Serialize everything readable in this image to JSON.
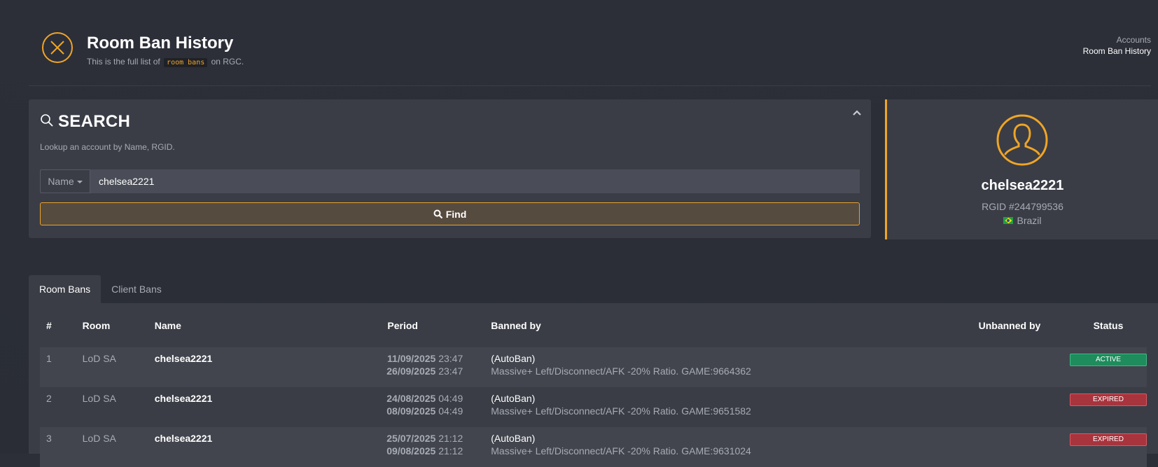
{
  "header": {
    "title": "Room Ban History",
    "subtitle_prefix": "This is the full list of",
    "subtitle_code": "room bans",
    "subtitle_suffix": "on RGC.",
    "breadcrumb": [
      "Accounts",
      "Room Ban History"
    ]
  },
  "search": {
    "title": "SEARCH",
    "description": "Lookup an account by Name, RGID.",
    "field_type": "Name",
    "input_value": "chelsea2221",
    "find_label": "Find"
  },
  "profile": {
    "name": "chelsea2221",
    "rgid": "RGID #244799536",
    "country": "Brazil"
  },
  "tabs": [
    "Room Bans",
    "Client Bans"
  ],
  "table": {
    "headers": [
      "#",
      "Room",
      "Name",
      "Period",
      "Banned by",
      "Unbanned by",
      "Status"
    ],
    "rows": [
      {
        "num": "1",
        "room": "LoD SA",
        "name": "chelsea2221",
        "start_date": "11/09/2025",
        "start_time": "23:47",
        "end_date": "26/09/2025",
        "end_time": "23:47",
        "banned_by": "(AutoBan)",
        "reason": "Massive+ Left/Disconnect/AFK -20% Ratio. GAME:9664362",
        "unbanned_by": "",
        "status": "ACTIVE"
      },
      {
        "num": "2",
        "room": "LoD SA",
        "name": "chelsea2221",
        "start_date": "24/08/2025",
        "start_time": "04:49",
        "end_date": "08/09/2025",
        "end_time": "04:49",
        "banned_by": "(AutoBan)",
        "reason": "Massive+ Left/Disconnect/AFK -20% Ratio. GAME:9651582",
        "unbanned_by": "",
        "status": "EXPIRED"
      },
      {
        "num": "3",
        "room": "LoD SA",
        "name": "chelsea2221",
        "start_date": "25/07/2025",
        "start_time": "21:12",
        "end_date": "09/08/2025",
        "end_time": "21:12",
        "banned_by": "(AutoBan)",
        "reason": "Massive+ Left/Disconnect/AFK -20% Ratio. GAME:9631024",
        "unbanned_by": "",
        "status": "EXPIRED"
      }
    ]
  },
  "colors": {
    "accent": "#f0a526",
    "active": "#1e8c5c",
    "expired": "#a8343d"
  }
}
